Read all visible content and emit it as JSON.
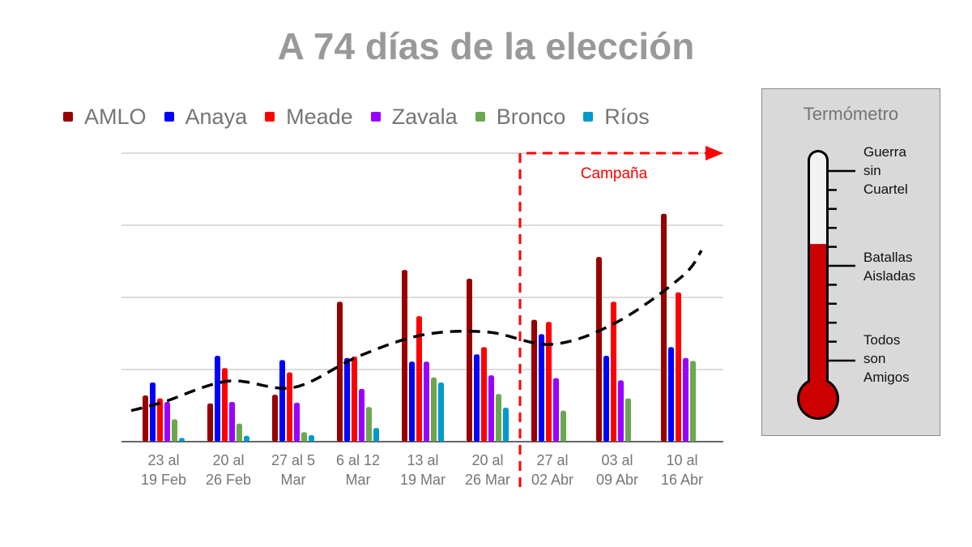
{
  "title": "A 74 días de la elección",
  "chart_data": {
    "type": "bar",
    "title": "A 74 días de la elección",
    "xlabel": "",
    "ylabel": "",
    "ylim": [
      0,
      4
    ],
    "grid": true,
    "yticks_labeled": false,
    "legend_position": "top",
    "categories": [
      [
        "23 al",
        "19 Feb"
      ],
      [
        "20 al",
        "26 Feb"
      ],
      [
        "27 al 5",
        "Mar"
      ],
      [
        "6 al 12",
        "Mar"
      ],
      [
        "13 al",
        "19 Mar"
      ],
      [
        "20 al",
        "26 Mar"
      ],
      [
        "27 al",
        "02 Abr"
      ],
      [
        "03 al",
        "09 Abr"
      ],
      [
        "10 al",
        "16 Abr"
      ]
    ],
    "series": [
      {
        "name": "AMLO",
        "color": "#990000",
        "values": [
          0.64,
          0.53,
          0.65,
          1.94,
          2.38,
          2.26,
          1.69,
          2.56,
          3.16
        ]
      },
      {
        "name": "Anaya",
        "color": "#0000ff",
        "values": [
          0.82,
          1.19,
          1.13,
          1.16,
          1.11,
          1.21,
          1.49,
          1.19,
          1.31
        ]
      },
      {
        "name": "Meade",
        "color": "#ff0000",
        "values": [
          0.6,
          1.02,
          0.96,
          1.18,
          1.74,
          1.31,
          1.66,
          1.94,
          2.07
        ]
      },
      {
        "name": "Zavala",
        "color": "#9900ff",
        "values": [
          0.55,
          0.55,
          0.54,
          0.73,
          1.11,
          0.92,
          0.88,
          0.85,
          1.16
        ]
      },
      {
        "name": "Bronco",
        "color": "#6aa84f",
        "values": [
          0.31,
          0.25,
          0.13,
          0.48,
          0.89,
          0.66,
          0.43,
          0.6,
          1.12
        ]
      },
      {
        "name": "Ríos",
        "color": "#0099cc",
        "values": [
          0.05,
          0.08,
          0.09,
          0.19,
          0.82,
          0.47,
          null,
          null,
          null
        ]
      }
    ],
    "trendline": {
      "style": "dashed",
      "color": "#000000",
      "x": [
        -0.5,
        0,
        1,
        2,
        3,
        4,
        5,
        6,
        7,
        8,
        8.3
      ],
      "y": [
        0.43,
        0.55,
        0.84,
        0.75,
        1.18,
        1.48,
        1.52,
        1.35,
        1.66,
        2.29,
        2.65
      ]
    },
    "annotation": {
      "text": "Campaña",
      "color": "#ff0000",
      "start_between_categories": [
        5,
        6
      ],
      "arrow_direction": "right"
    }
  },
  "thermometer": {
    "title": "Termómetro",
    "level": 0.615,
    "fill_color": "#cc0000",
    "labels": [
      {
        "text": "Guerra\nsin\nCuartel",
        "level": 1.0
      },
      {
        "text": "Batallas\nAisladas",
        "level": 0.5
      },
      {
        "text": "Todos\nson\nAmigos",
        "level": 0.0
      }
    ]
  }
}
